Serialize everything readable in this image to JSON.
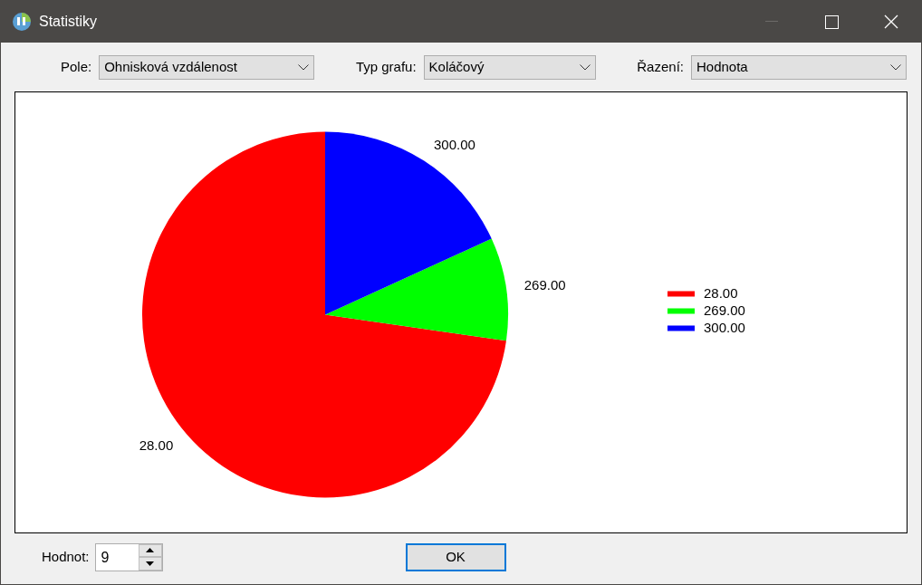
{
  "window": {
    "title": "Statistiky"
  },
  "controls": [
    {
      "label": "Pole:",
      "value": "Ohnisková vzdálenost"
    },
    {
      "label": "Typ grafu:",
      "value": "Koláčový"
    },
    {
      "label": "Řazení:",
      "value": "Hodnota"
    }
  ],
  "chart": {
    "chart_data": {
      "type": "pie",
      "categories": [
        "28.00",
        "269.00",
        "300.00"
      ],
      "series": [
        {
          "values": [
            72.73,
            9.09,
            18.18
          ]
        }
      ],
      "colors": [
        "#ff0000",
        "#00ff00",
        "#0000ff"
      ],
      "legend": true
    }
  },
  "count": {
    "label": "Hodnot:",
    "value": "9"
  },
  "ok_button": "OK"
}
